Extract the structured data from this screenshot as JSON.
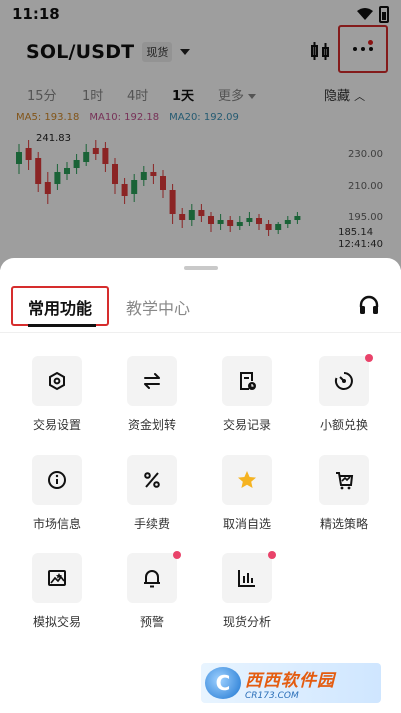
{
  "status_bar": {
    "time": "11:18"
  },
  "header": {
    "pair": "SOL/USDT",
    "market_badge": "现货"
  },
  "intervals": [
    "15分",
    "1时",
    "4时",
    "1天",
    "更多",
    "隐藏"
  ],
  "active_interval": "1天",
  "ma": {
    "ma5": "MA5: 193.18",
    "ma10": "MA10: 192.18",
    "ma20": "MA20: 192.09"
  },
  "chart_data": {
    "type": "candlestick",
    "y_ticks": [
      "230.00",
      "210.00",
      "195.00"
    ],
    "high_marker": "241.83",
    "last_price": "185.14",
    "countdown": "12:41:40",
    "colors": {
      "up": "#2aa15a",
      "down": "#e03a3a"
    }
  },
  "sheet": {
    "tabs": [
      "常用功能",
      "教学中心"
    ],
    "active_tab": "常用功能",
    "items": [
      {
        "label": "交易设置",
        "icon": "hexagon-icon",
        "badge": false
      },
      {
        "label": "资金划转",
        "icon": "transfer-icon",
        "badge": false
      },
      {
        "label": "交易记录",
        "icon": "record-icon",
        "badge": false
      },
      {
        "label": "小额兑换",
        "icon": "dust-convert-icon",
        "badge": true
      },
      {
        "label": "市场信息",
        "icon": "info-icon",
        "badge": false
      },
      {
        "label": "手续费",
        "icon": "percent-icon",
        "badge": false
      },
      {
        "label": "取消自选",
        "icon": "star-icon",
        "badge": false
      },
      {
        "label": "精选策略",
        "icon": "strategy-icon",
        "badge": false
      },
      {
        "label": "模拟交易",
        "icon": "demo-trade-icon",
        "badge": false
      },
      {
        "label": "预警",
        "icon": "bell-icon",
        "badge": true
      },
      {
        "label": "现货分析",
        "icon": "analysis-icon",
        "badge": true
      }
    ]
  },
  "watermark": {
    "logo": "C",
    "main": "西西软件园",
    "sub": "CR173.COM"
  },
  "accent": {
    "highlight": "#d62d2d",
    "star": "#f5b321",
    "badge": "#e9436a"
  }
}
